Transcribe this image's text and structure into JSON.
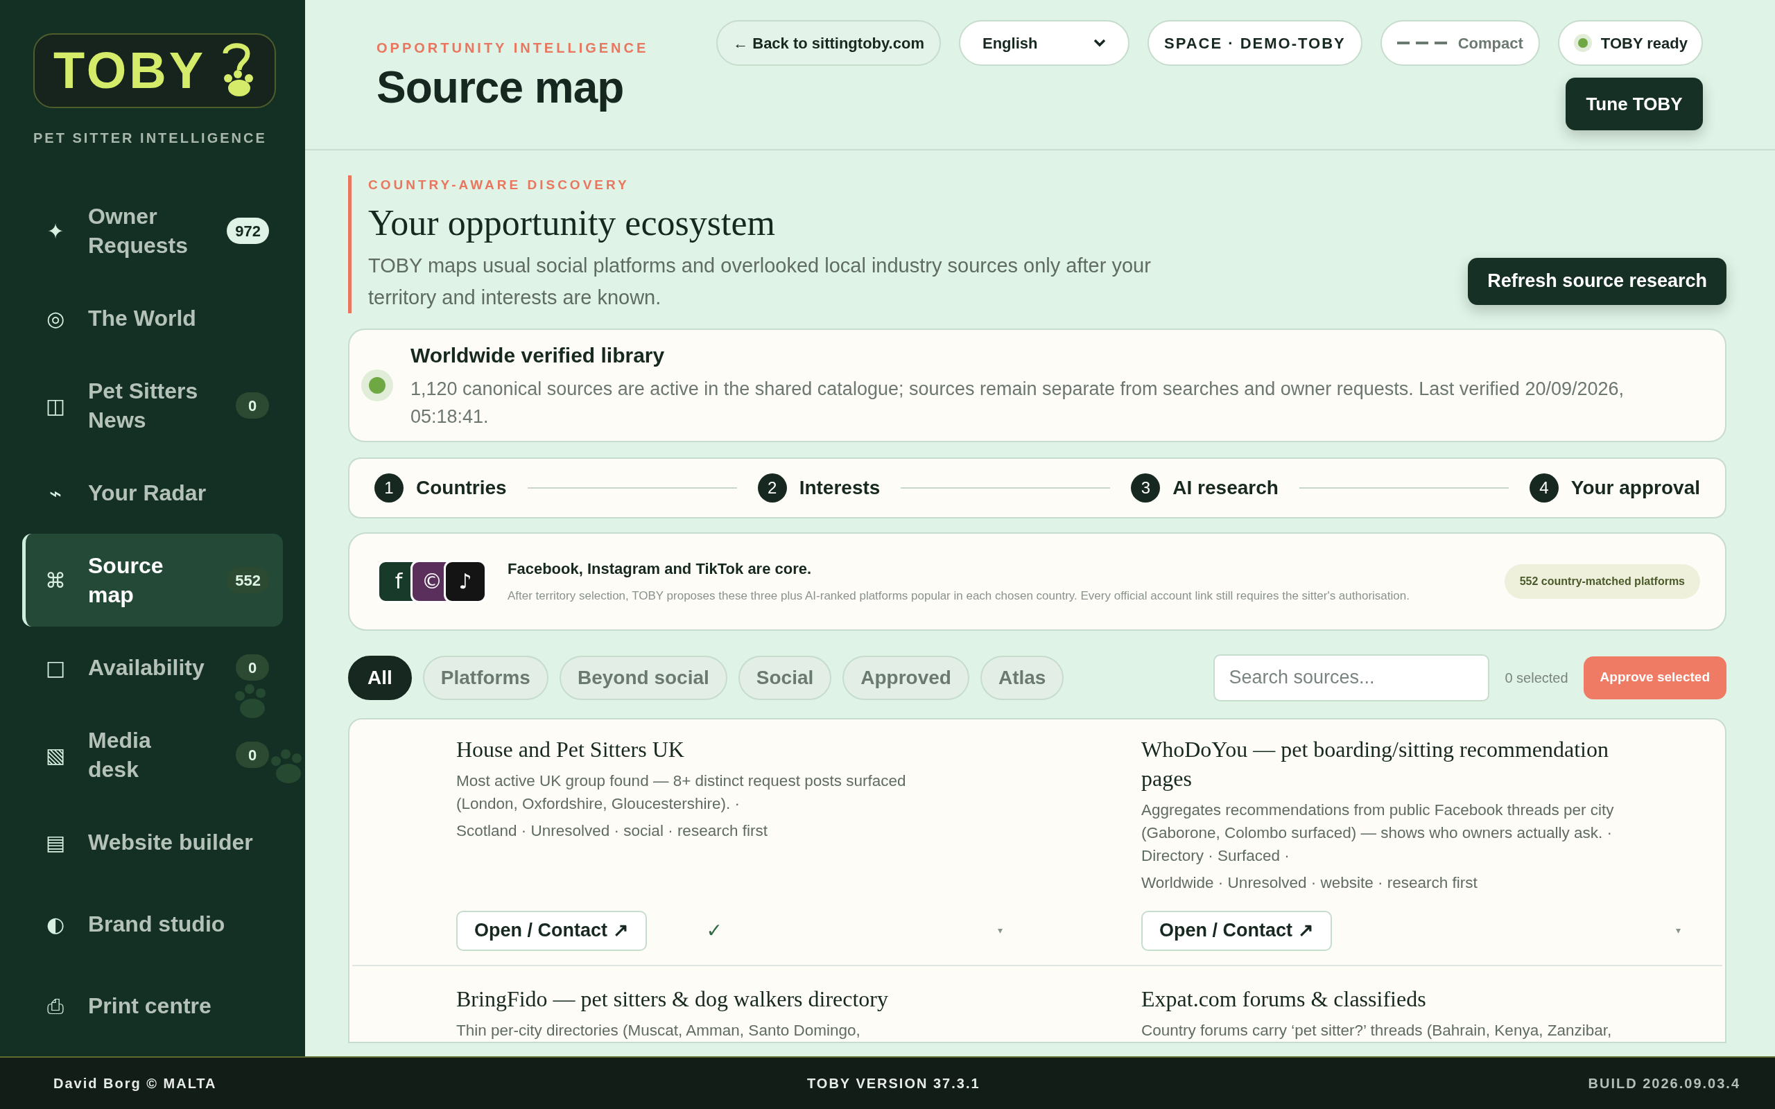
{
  "sidebar": {
    "logo": "TOBY",
    "tagline": "PET SITTER INTELLIGENCE",
    "items": [
      {
        "glyph": "✦",
        "label": "Owner Requests",
        "badge": "972",
        "badge_highlight": true,
        "selected": false
      },
      {
        "glyph": "◎",
        "label": "The World",
        "selected": false
      },
      {
        "glyph": "◫",
        "label": "Pet Sitters News",
        "badge": "0",
        "badge_highlight": false,
        "selected": false
      },
      {
        "glyph": "⌁",
        "label": "Your Radar",
        "selected": false
      },
      {
        "glyph": "⌘",
        "label": "Source map",
        "badge": "552",
        "badge_highlight": false,
        "selected": true
      },
      {
        "glyph": "□",
        "label": "Availability",
        "badge": "0",
        "badge_highlight": false,
        "selected": false
      },
      {
        "glyph": "▧",
        "label": "Media desk",
        "badge": "0",
        "badge_highlight": false,
        "selected": false
      },
      {
        "glyph": "▤",
        "label": "Website builder",
        "selected": false
      },
      {
        "glyph": "◐",
        "label": "Brand studio",
        "selected": false
      },
      {
        "glyph": "⎙",
        "label": "Print centre",
        "selected": false
      }
    ]
  },
  "header": {
    "eyebrow": "OPPORTUNITY INTELLIGENCE",
    "title": "Source map",
    "back_link": "← Back to sittingtoby.com",
    "language": "English",
    "space": "SPACE · DEMO-TOBY",
    "density": "Compact",
    "status": "TOBY ready",
    "tune_button": "Tune TOBY"
  },
  "intro": {
    "eyebrow": "COUNTRY-AWARE DISCOVERY",
    "title": "Your opportunity ecosystem",
    "text": "TOBY maps usual social platforms and overlooked local industry sources only after your territory and interests are known.",
    "refresh_button": "Refresh source research"
  },
  "library": {
    "title": "Worldwide verified library",
    "text": "1,120 canonical sources are active in the shared catalogue; sources remain separate from searches and owner requests. Last verified 20/09/2026, 05:18:41."
  },
  "steps": [
    {
      "number": "1",
      "label": "Countries"
    },
    {
      "number": "2",
      "label": "Interests"
    },
    {
      "number": "3",
      "label": "AI research"
    },
    {
      "number": "4",
      "label": "Your approval"
    }
  ],
  "core": {
    "platform_icons": [
      {
        "glyph": "f",
        "color": "#173a2b"
      },
      {
        "glyph": "©",
        "color": "#5a2f5c"
      },
      {
        "glyph": "♪",
        "color": "#141414"
      }
    ],
    "title": "Facebook, Instagram and TikTok are core.",
    "text": "After territory selection, TOBY proposes these three plus AI-ranked platforms popular in each chosen country. Every official account link still requires the sitter's authorisation.",
    "badge": "552 country-matched platforms"
  },
  "filters": [
    {
      "label": "All",
      "selected": true
    },
    {
      "label": "Platforms",
      "selected": false
    },
    {
      "label": "Beyond social",
      "selected": false
    },
    {
      "label": "Social",
      "selected": false
    },
    {
      "label": "Approved",
      "selected": false
    },
    {
      "label": "Atlas",
      "selected": false
    }
  ],
  "search": {
    "placeholder": "Search sources..."
  },
  "selected_count": "0 selected",
  "approve_button": "Approve selected",
  "sources": [
    {
      "title": "House and Pet Sitters UK",
      "description": "Most active UK group found — 8+ distinct request posts surfaced (London, Oxfordshire, Gloucestershire). ·",
      "meta": "Scotland · Unresolved · social · research first",
      "button": "Open / Contact ↗",
      "mark": "✓",
      "caret": "▾"
    },
    {
      "title": "WhoDoYou — pet boarding/sitting recommendation pages",
      "description": "Aggregates recommendations from public Facebook threads per city (Gaborone, Colombo surfaced) — shows who owners actually ask. · Directory · Surfaced ·",
      "meta": "Worldwide · Unresolved · website · research first",
      "button": "Open / Contact ↗",
      "caret": "▾"
    },
    {
      "title": "BringFido — pet sitters & dog walkers directory",
      "description": "Thin per-city directories (Muscat, Amman, Santo Domingo,"
    },
    {
      "title": "Expat.com forums & classifieds",
      "description": "Country forums carry ‘pet sitter?’ threads (Bahrain, Kenya, Zanzibar,"
    }
  ],
  "footer": {
    "left": "David Borg © MALTA",
    "center": "TOBY VERSION 37.3.1",
    "right": "BUILD 2026.09.03.4"
  }
}
